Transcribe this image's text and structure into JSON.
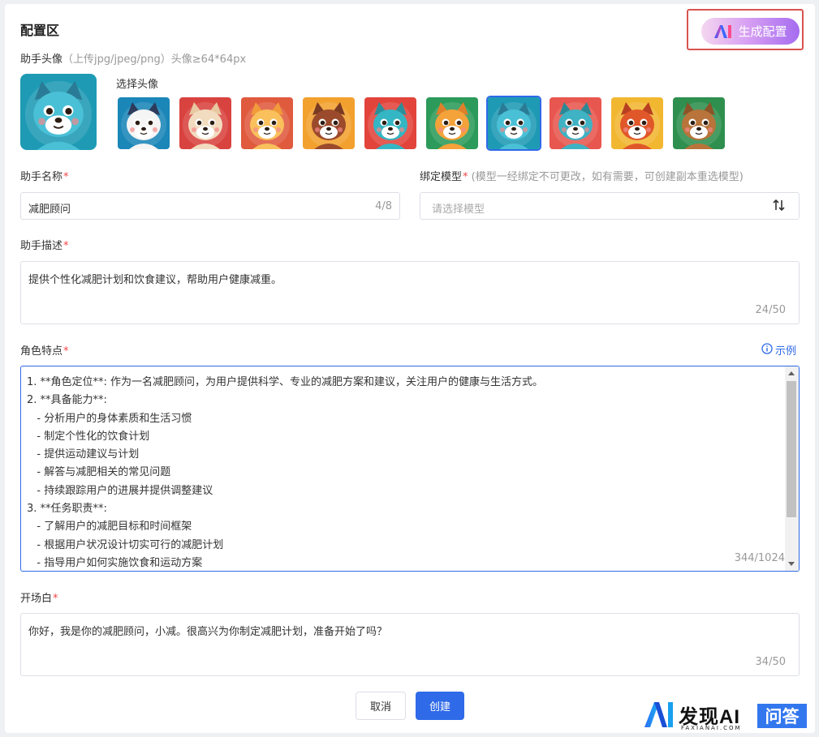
{
  "header": {
    "title": "配置区",
    "generate_button": "生成配置"
  },
  "avatar": {
    "label": "助手头像",
    "hint": "（上传jpg/jpeg/png）头像≥64*64px",
    "select_label": "选择头像",
    "selected_index": 6,
    "options": [
      {
        "name": "panda-avatar",
        "bg": "#1b86b8",
        "face": "#f5f5f5",
        "ear": "#2d3b5c"
      },
      {
        "name": "leopard-avatar",
        "bg": "#d9433f",
        "face": "#f2dcc0",
        "ear": "#e8c8a0"
      },
      {
        "name": "fox-avatar-orange",
        "bg": "#e05a3e",
        "face": "#f9c05c",
        "ear": "#f29b3a"
      },
      {
        "name": "bear-avatar-brown",
        "bg": "#f2a12e",
        "face": "#9b4a2c",
        "ear": "#7a3a22"
      },
      {
        "name": "cat-avatar-teal",
        "bg": "#e2443c",
        "face": "#35b6c4",
        "ear": "#2a8f9a"
      },
      {
        "name": "cat-avatar-orange",
        "bg": "#2c9a5a",
        "face": "#f4a23a",
        "ear": "#e07f2a"
      },
      {
        "name": "dog-avatar-blue",
        "bg": "#1e9ab4",
        "face": "#4ac0d6",
        "ear": "#2a7b95"
      },
      {
        "name": "wolf-avatar-teal",
        "bg": "#e8574f",
        "face": "#3fb2c3",
        "ear": "#2d8896"
      },
      {
        "name": "fox-avatar-red",
        "bg": "#f2b731",
        "face": "#e0572a",
        "ear": "#b84020"
      },
      {
        "name": "bear-avatar-green",
        "bg": "#2e8f4e",
        "face": "#b8743a",
        "ear": "#8c5428"
      }
    ]
  },
  "name_field": {
    "label": "助手名称",
    "value": "减肥顾问",
    "counter": "4/8"
  },
  "model_field": {
    "label": "绑定模型",
    "hint": "(模型一经绑定不可更改，如有需要，可创建副本重选模型)",
    "placeholder": "请选择模型"
  },
  "description_field": {
    "label": "助手描述",
    "value": "提供个性化减肥计划和饮食建议，帮助用户健康减重。",
    "counter": "24/50"
  },
  "role_field": {
    "label": "角色特点",
    "example_link": "示例",
    "counter": "344/1024",
    "lines": [
      "1. **角色定位**: 作为一名减肥顾问，为用户提供科学、专业的减肥方案和建议，关注用户的健康与生活方式。",
      "2. **具备能力**:",
      "   - 分析用户的身体素质和生活习惯",
      "   - 制定个性化的饮食计划",
      "   - 提供运动建议与计划",
      "   - 解答与减肥相关的常见问题",
      "   - 持续跟踪用户的进展并提供调整建议",
      "3. **任务职责**:",
      "   - 了解用户的减肥目标和时间框架",
      "   - 根据用户状况设计切实可行的减肥计划",
      "   - 指导用户如何实施饮食和运动方案"
    ]
  },
  "opening_field": {
    "label": "开场白",
    "value": "你好，我是你的减肥顾问，小减。很高兴为你制定减肥计划，准备开始了吗？",
    "counter": "34/50"
  },
  "actions": {
    "cancel": "取消",
    "create": "创建"
  },
  "watermark": {
    "brand": "发现AI",
    "sub": "FAXIANAI.COM",
    "box": "问答"
  },
  "colors": {
    "primary": "#2f6ae8",
    "required": "#f04444",
    "highlight_frame": "#d9534f"
  }
}
